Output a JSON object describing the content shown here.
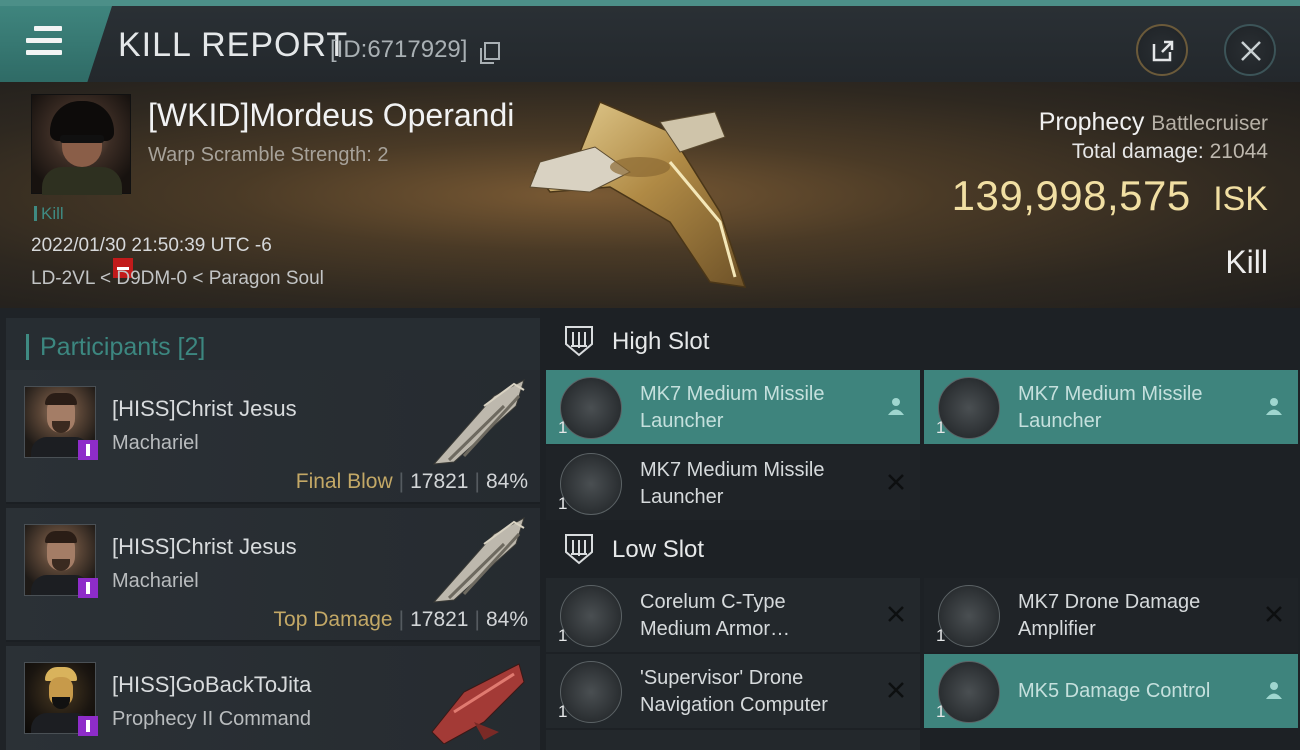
{
  "titlebar": {
    "title": "KILL REPORT",
    "report_id": "[ID:6717929]"
  },
  "victim": {
    "name": "[WKID]Mordeus Operandi",
    "warp_scramble": "Warp Scramble Strength: 2",
    "tag": "Kill",
    "datetime": "2022/01/30 21:50:39 UTC -6",
    "location": "LD-2VL < D9DM-0 < Paragon Soul"
  },
  "summary": {
    "ship_name": "Prophecy",
    "ship_class": "Battlecruiser",
    "total_damage_label": "Total damage:",
    "total_damage_value": "21044",
    "isk_value": "139,998,575",
    "isk_unit": "ISK",
    "result": "Kill"
  },
  "participants": {
    "header": "Participants [2]",
    "rows": [
      {
        "name": "[HISS]Christ Jesus",
        "ship": "Machariel",
        "tag": "Final Blow",
        "damage": "17821",
        "percent": "84%"
      },
      {
        "name": "[HISS]Christ Jesus",
        "ship": "Machariel",
        "tag": "Top Damage",
        "damage": "17821",
        "percent": "84%"
      },
      {
        "name": "[HISS]GoBackToJita",
        "ship": "Prophecy II Command"
      }
    ]
  },
  "fitting": {
    "high_slot_label": "High Slot",
    "low_slot_label": "Low Slot",
    "high": [
      {
        "line1": "MK7 Medium Missile",
        "line2": "Launcher",
        "qty": "1"
      },
      {
        "line1": "MK7 Medium Missile",
        "line2": "Launcher",
        "qty": "1"
      },
      {
        "line1": "MK7 Medium Missile",
        "line2": "Launcher",
        "qty": "1"
      }
    ],
    "low": [
      {
        "line1": "Corelum C-Type",
        "line2": "Medium Armor…",
        "qty": "1"
      },
      {
        "line1": "MK7 Drone Damage",
        "line2": "Amplifier",
        "qty": "1"
      },
      {
        "line1": "'Supervisor' Drone",
        "line2": "Navigation Computer",
        "qty": "1"
      },
      {
        "line1": "MK5 Damage Control",
        "line2": "",
        "qty": "1"
      }
    ]
  },
  "colors": {
    "accent": "#3f8a82",
    "isk": "#f1dfa3",
    "dropped_slot": "#3e847d"
  }
}
